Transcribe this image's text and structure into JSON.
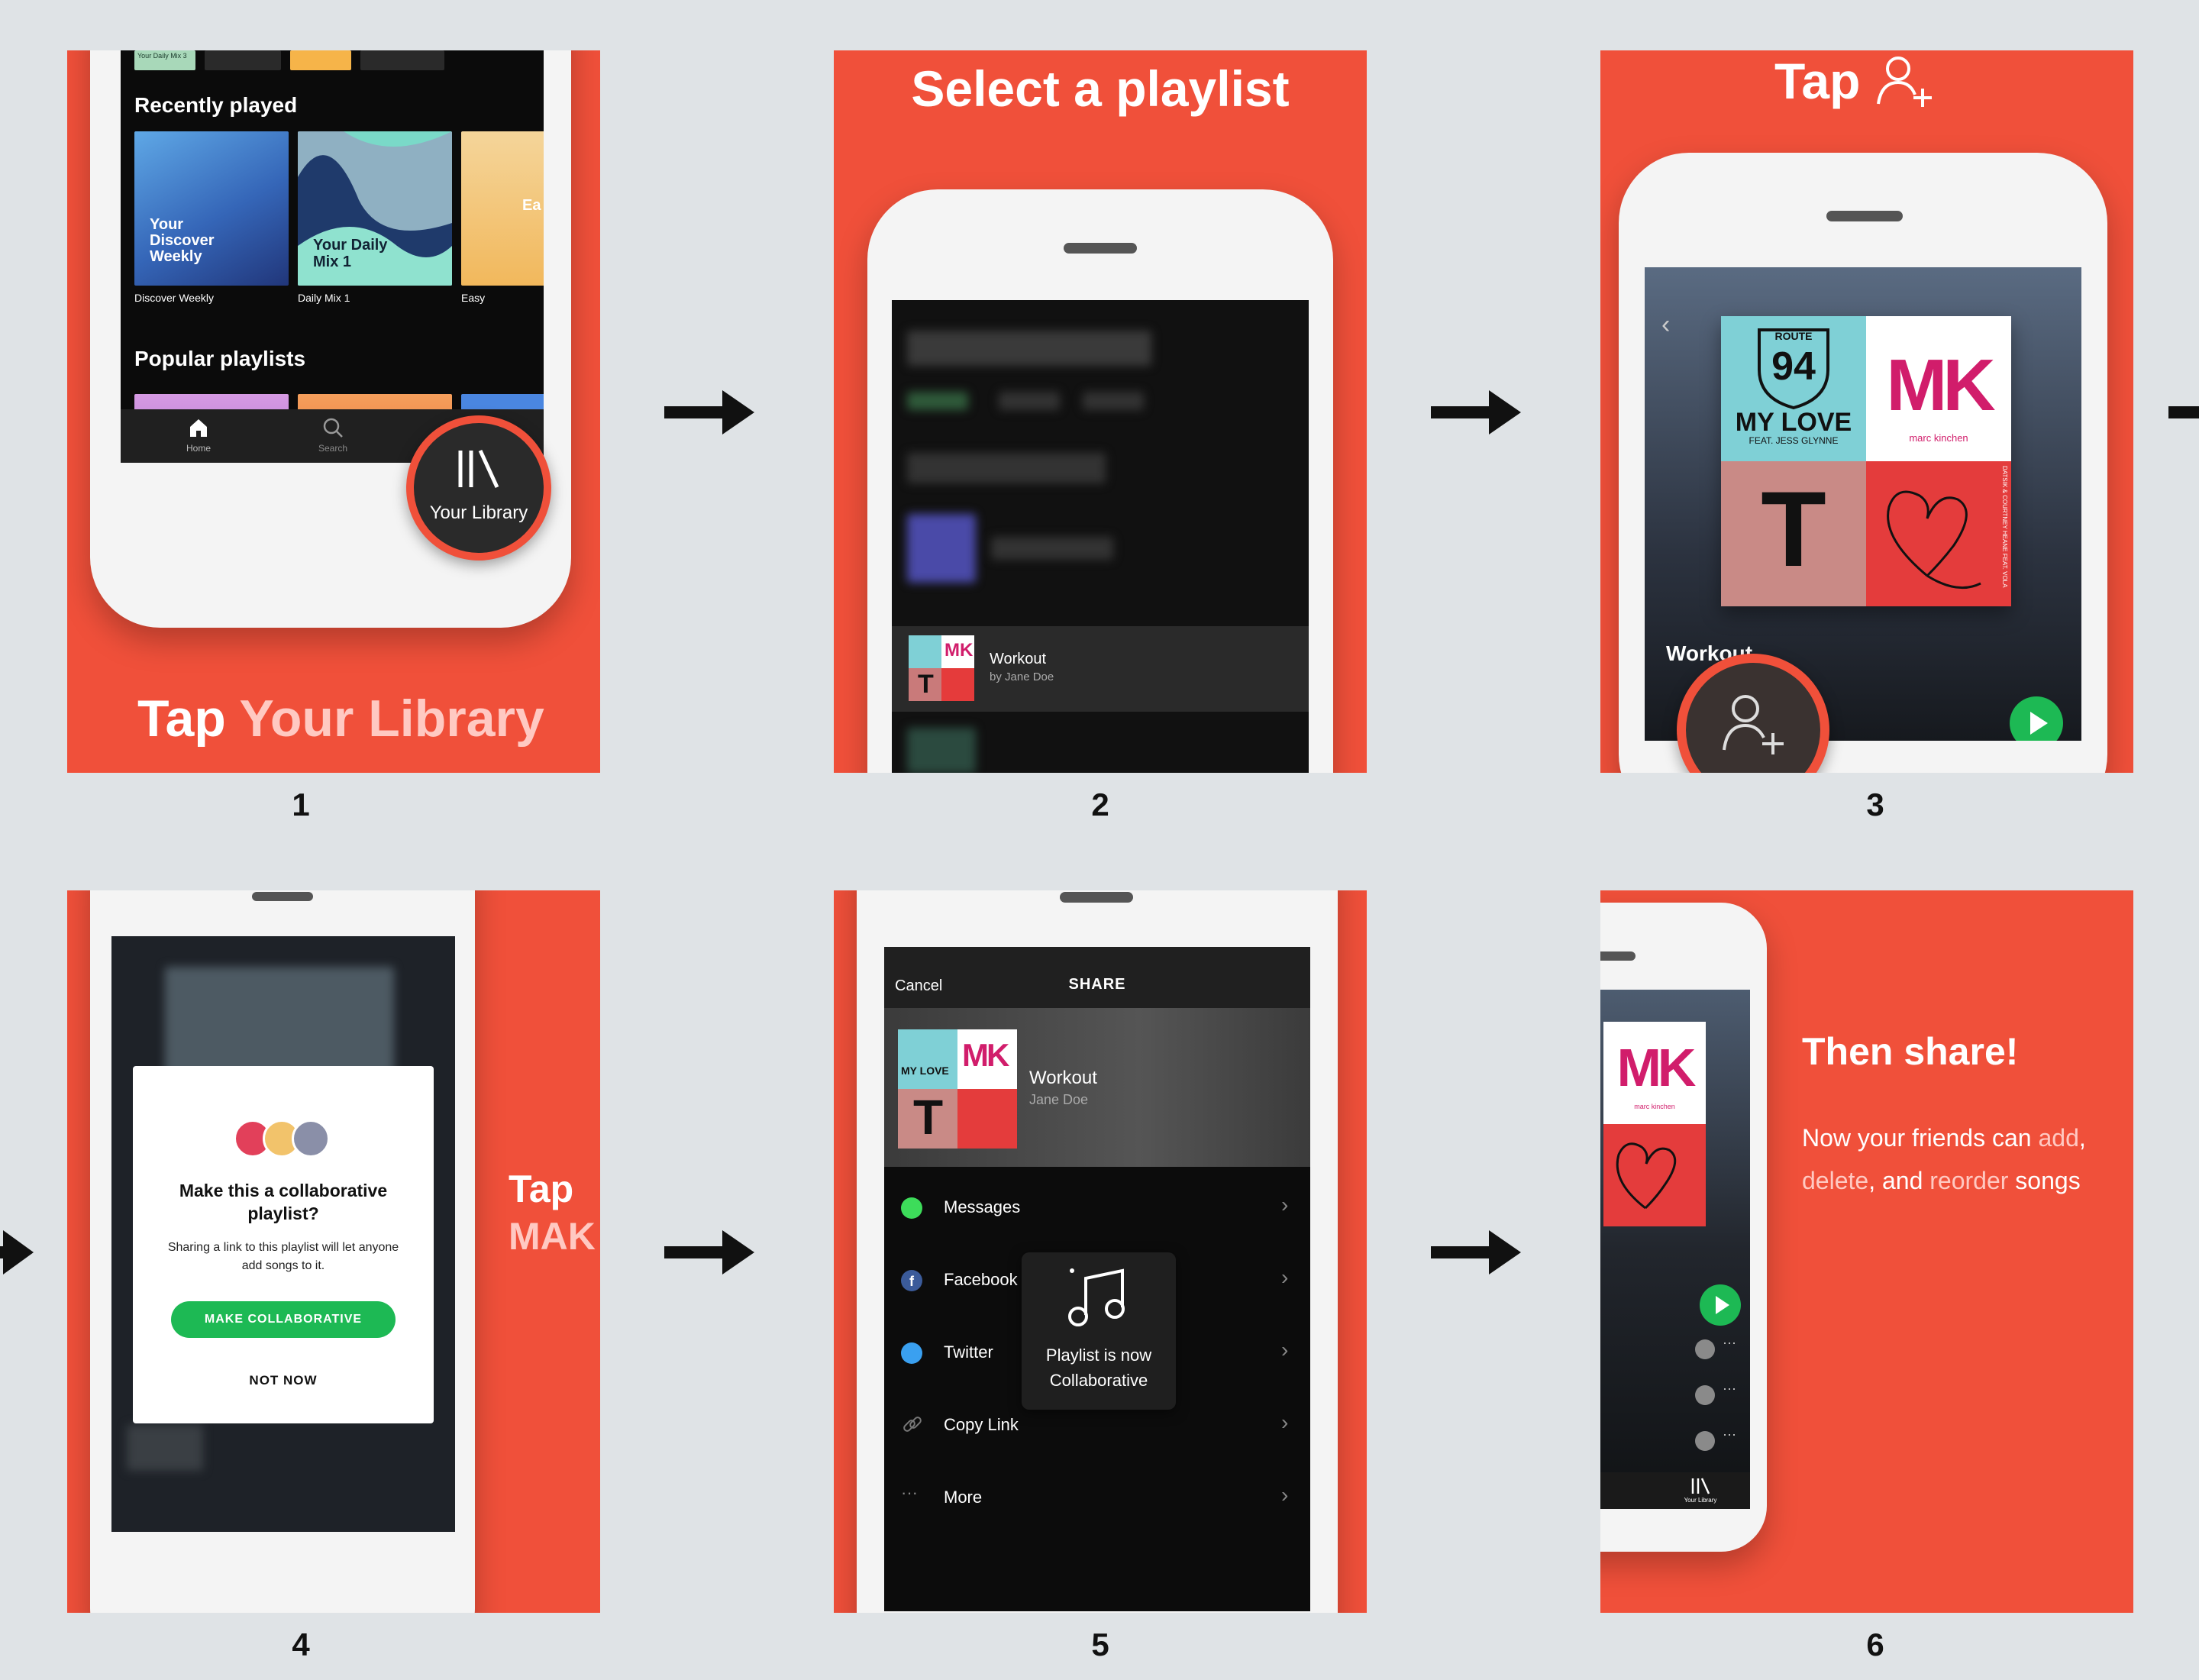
{
  "steps": [
    {
      "number": "1",
      "headline_part1": "Tap",
      "headline_part2": "Your Library",
      "screen": {
        "top_tile_caption": "Your Daily Mix 3",
        "recently_played_title": "Recently played",
        "tiles": [
          {
            "cover_text": "Your Discover Weekly",
            "caption": "Discover Weekly"
          },
          {
            "cover_text": "Your Daily Mix 1",
            "caption": "Daily Mix 1"
          },
          {
            "cover_text": "Ea",
            "caption": "Easy"
          }
        ],
        "popular_title": "Popular playlists",
        "tabs": [
          "Home",
          "Search"
        ],
        "library_button_label": "Your Library"
      }
    },
    {
      "number": "2",
      "headline": "Select a playlist",
      "screen": {
        "blurred_header": "Made Robots",
        "selected_playlist_title": "Workout",
        "selected_playlist_owner": "by Jane Doe"
      }
    },
    {
      "number": "3",
      "headline": "Tap",
      "screen": {
        "playlist_title": "Workout",
        "covers": {
          "q1_top": "ROUTE",
          "q1_num": "94",
          "q1_title": "MY LOVE",
          "q1_feat": "FEAT. JESS GLYNNE",
          "q2_logo": "MK",
          "q2_name": "marc kinchen",
          "q3_letter": "T",
          "q4_side": "DATSIK & COURTNEY HEANE FEAT. VOLA"
        }
      }
    },
    {
      "number": "4",
      "headline_line1": "Tap",
      "headline_line2": "MAK",
      "dialog": {
        "title": "Make this a collaborative playlist?",
        "body": "Sharing a link to this playlist will let anyone add songs to it.",
        "primary_button": "MAKE COLLABORATIVE",
        "secondary_button": "NOT NOW"
      }
    },
    {
      "number": "5",
      "screen": {
        "cancel_label": "Cancel",
        "share_title": "SHARE",
        "playlist_title": "Workout",
        "playlist_owner": "Jane Doe",
        "options": [
          "Messages",
          "Facebook",
          "Twitter",
          "Copy Link",
          "More"
        ],
        "toast": "Playlist is now Collaborative"
      }
    },
    {
      "number": "6",
      "headline": "Then share!",
      "body_parts": [
        "Now your friends can ",
        "add",
        ",",
        "delete",
        ", and ",
        "reorder",
        " songs"
      ],
      "screen": {
        "library_label": "Your Library"
      }
    }
  ],
  "colors": {
    "background": "#dfe3e6",
    "panel_red": "#f0503a",
    "spotify_green": "#1db954",
    "highlight_pink": "#ffc9c2"
  },
  "icons": [
    "arrow-right-icon",
    "home-icon",
    "search-icon",
    "library-icon",
    "add-user-icon",
    "play-icon",
    "shuffle-icon",
    "music-note-icon",
    "messages-icon",
    "facebook-icon",
    "twitter-icon",
    "link-icon",
    "more-icon",
    "chevron-right-icon",
    "back-icon"
  ]
}
